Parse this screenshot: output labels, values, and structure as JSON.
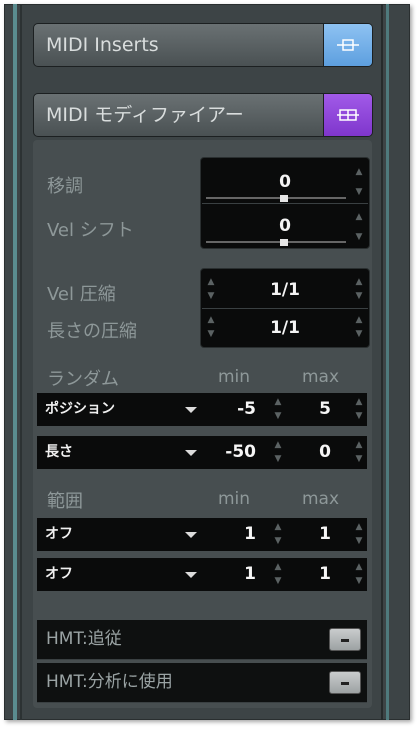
{
  "headers": {
    "inserts": {
      "label": "MIDI Inserts",
      "color": "#6aa9e6"
    },
    "modifiers": {
      "label": "MIDI モディファイアー",
      "color": "#8f45dc"
    }
  },
  "transpose": {
    "label": "移調",
    "value": "0"
  },
  "vel_shift": {
    "label": "Vel シフト",
    "value": "0"
  },
  "vel_compress": {
    "label": "Vel 圧縮",
    "value": "1/1"
  },
  "length_compress": {
    "label": "長さの圧縮",
    "value": "1/1"
  },
  "random": {
    "title": "ランダム",
    "min_label": "min",
    "max_label": "max",
    "rows": [
      {
        "type": "ポジション",
        "min": "-5",
        "max": "5"
      },
      {
        "type": "長さ",
        "min": "-50",
        "max": "0"
      }
    ]
  },
  "range": {
    "title": "範囲",
    "min_label": "min",
    "max_label": "max",
    "rows": [
      {
        "type": "オフ",
        "min": "1",
        "max": "1"
      },
      {
        "type": "オフ",
        "min": "1",
        "max": "1"
      }
    ]
  },
  "hmt": {
    "follow_label": "HMT:追従",
    "analysis_label": "HMT:分析に使用"
  }
}
